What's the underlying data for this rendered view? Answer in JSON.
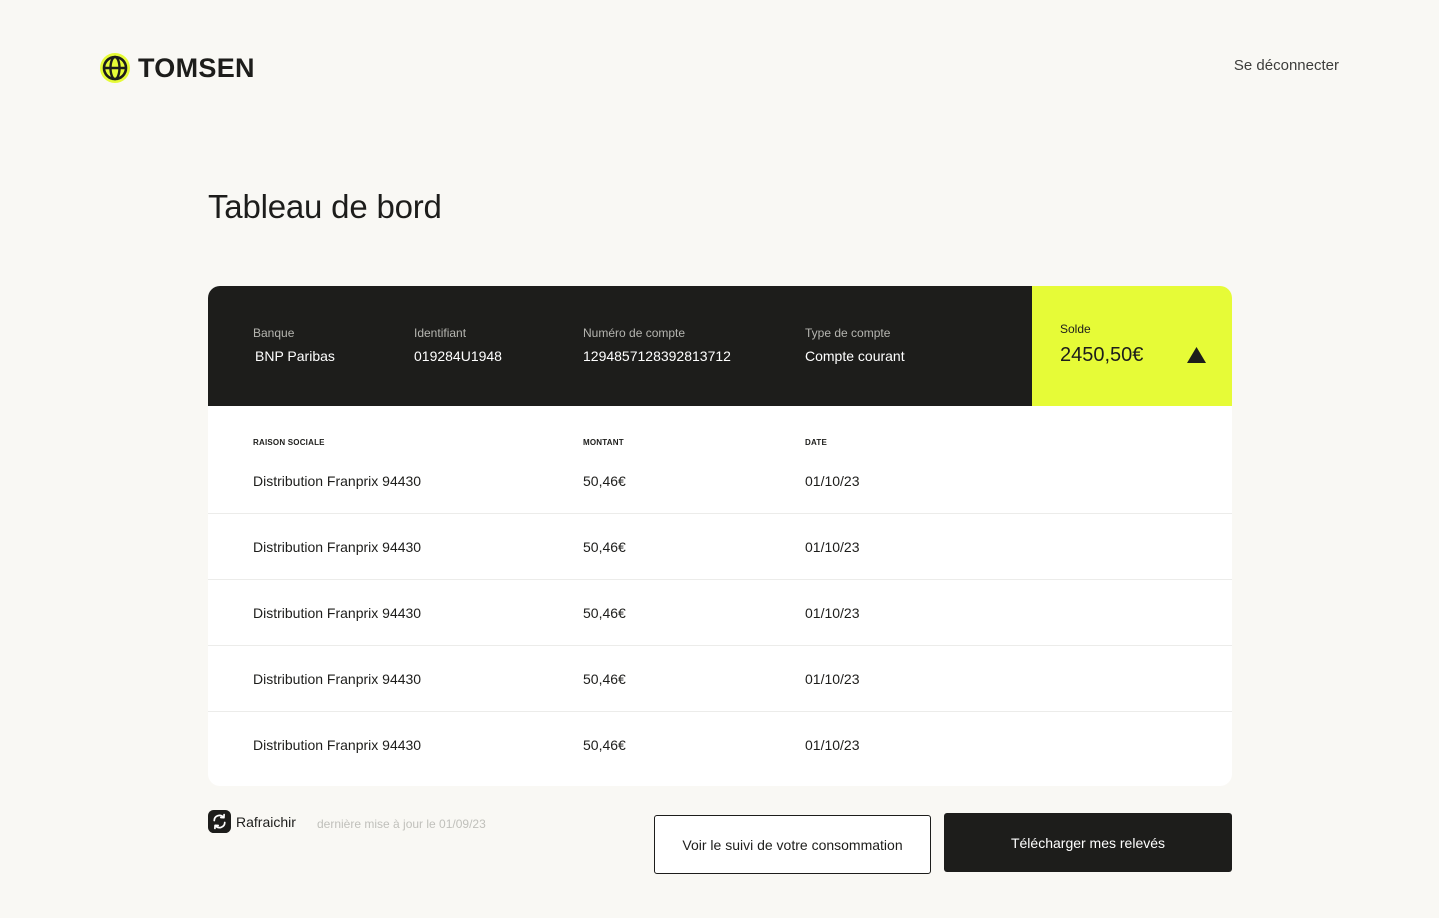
{
  "brand": {
    "name": "TOMSEN",
    "accent": "#e6fb37",
    "dark": "#1d1d1b"
  },
  "header": {
    "logout_label": "Se déconnecter"
  },
  "page": {
    "title": "Tableau de bord"
  },
  "account": {
    "bank_label": "Banque",
    "bank_value": "BNP Paribas",
    "id_label": "Identifiant",
    "id_value": "019284U1948",
    "number_label": "Numéro de compte",
    "number_value": "1294857128392813712",
    "type_label": "Type de compte",
    "type_value": "Compte courant"
  },
  "balance": {
    "label": "Solde",
    "value": "2450,50€",
    "trend_icon": "triangle-up-icon"
  },
  "table": {
    "headers": [
      "RAISON SOCIALE",
      "MONTANT",
      "DATE"
    ],
    "rows": [
      [
        "Distribution Franprix 94430",
        "50,46€",
        "01/10/23"
      ],
      [
        "Distribution Franprix 94430",
        "50,46€",
        "01/10/23"
      ],
      [
        "Distribution Franprix 94430",
        "50,46€",
        "01/10/23"
      ],
      [
        "Distribution Franprix 94430",
        "50,46€",
        "01/10/23"
      ],
      [
        "Distribution Franprix 94430",
        "50,46€",
        "01/10/23"
      ]
    ]
  },
  "footer": {
    "refresh_label": "Rafraichir",
    "refresh_icon": "refresh-icon",
    "last_update": "dernière mise à jour le 01/09/23",
    "consumption_button": "Voir le suivi de votre consommation",
    "download_button": "Télécharger mes relevés"
  }
}
